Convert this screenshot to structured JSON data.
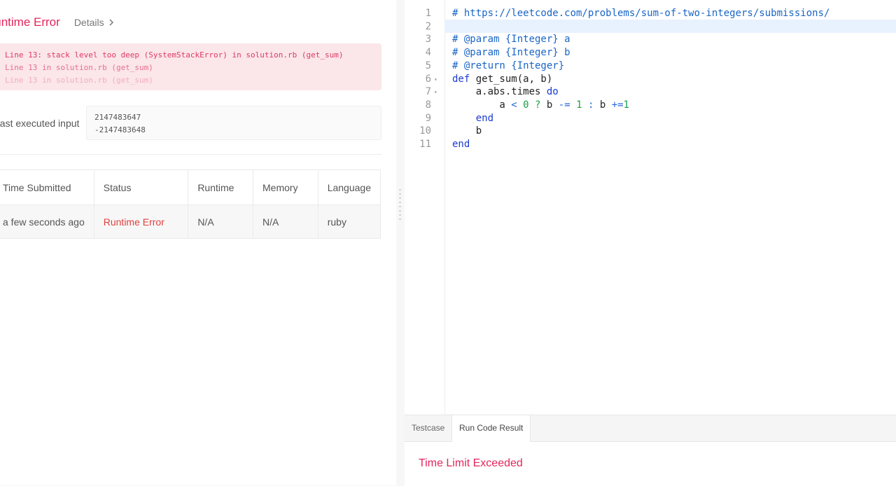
{
  "result": {
    "status_title": "Runtime Error",
    "details_label": "Details",
    "error_lines": [
      "Line 13: stack level too deep (SystemStackError) in solution.rb (get_sum)",
      "Line 13 in solution.rb (get_sum)",
      "Line 13 in solution.rb (get_sum)"
    ],
    "last_input_label": "Last executed input",
    "last_input_values": [
      "2147483647",
      "-2147483648"
    ]
  },
  "submissions": {
    "headers": [
      "Time Submitted",
      "Status",
      "Runtime",
      "Memory",
      "Language"
    ],
    "rows": [
      {
        "time": "a few seconds ago",
        "status": "Runtime Error",
        "runtime": "N/A",
        "memory": "N/A",
        "language": "ruby"
      }
    ]
  },
  "editor": {
    "line_numbers": [
      "1",
      "2",
      "3",
      "4",
      "5",
      "6",
      "7",
      "8",
      "9",
      "10",
      "11"
    ],
    "fold_markers": {
      "6": "▾",
      "7": "▾"
    },
    "lines": [
      [
        {
          "t": "comment",
          "v": "# https://leetcode.com/problems/sum-of-two-integers/submissions/"
        }
      ],
      [],
      [
        {
          "t": "comment",
          "v": "# @param {Integer} a"
        }
      ],
      [
        {
          "t": "comment",
          "v": "# @param {Integer} b"
        }
      ],
      [
        {
          "t": "comment",
          "v": "# @return {Integer}"
        }
      ],
      [
        {
          "t": "kw",
          "v": "def "
        },
        {
          "t": "plain",
          "v": "get_sum(a, b)"
        }
      ],
      [
        {
          "t": "plain",
          "v": "    a.abs.times "
        },
        {
          "t": "kw",
          "v": "do"
        }
      ],
      [
        {
          "t": "plain",
          "v": "        a "
        },
        {
          "t": "op",
          "v": "<"
        },
        {
          "t": "plain",
          "v": " "
        },
        {
          "t": "num",
          "v": "0"
        },
        {
          "t": "plain",
          "v": " "
        },
        {
          "t": "num",
          "v": "?"
        },
        {
          "t": "plain",
          "v": " b "
        },
        {
          "t": "op",
          "v": "-="
        },
        {
          "t": "plain",
          "v": " "
        },
        {
          "t": "num",
          "v": "1"
        },
        {
          "t": "plain",
          "v": " "
        },
        {
          "t": "op",
          "v": ":"
        },
        {
          "t": "plain",
          "v": " b "
        },
        {
          "t": "op",
          "v": "+="
        },
        {
          "t": "num",
          "v": "1"
        }
      ],
      [
        {
          "t": "kw",
          "v": "    end"
        }
      ],
      [
        {
          "t": "plain",
          "v": "    b"
        }
      ],
      [
        {
          "t": "kw",
          "v": "end"
        }
      ]
    ]
  },
  "console": {
    "tabs": [
      "Testcase",
      "Run Code Result"
    ],
    "active_tab": "Run Code Result",
    "result_status": "Time Limit Exceeded"
  },
  "colors": {
    "error_pink": "#e3265c",
    "status_red": "#e0403f",
    "comment_blue": "#1a65c7",
    "keyword_blue": "#1a3ad1",
    "number_green": "#1ba049"
  }
}
